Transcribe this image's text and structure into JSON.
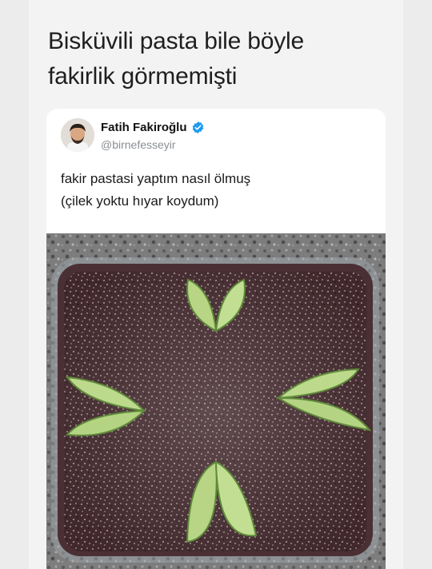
{
  "headline": {
    "line1": "Bisküvili pasta bile böyle",
    "line2": "fakirlik görmemişti"
  },
  "tweet": {
    "author_name": "Fatih Fakiroğlu",
    "handle": "@birnefesseyir",
    "verified_icon": "verified-badge-icon",
    "text_line1": "fakir pastasi yaptım nasıl ölmuş",
    "text_line2": "(çilek yoktu hıyar koydum)",
    "media": "cake-photo"
  },
  "colors": {
    "verified": "#1d9bf0",
    "cake": "#3a2226",
    "cucumber": "#b9d88a"
  }
}
